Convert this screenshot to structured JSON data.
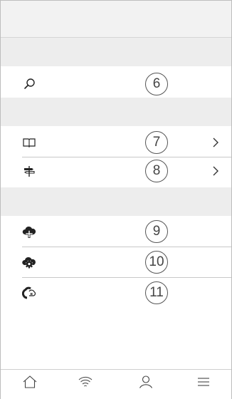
{
  "badges": {
    "search": "6",
    "book": "7",
    "signpost": "8",
    "cloud_add": "9",
    "cloud_settings": "10",
    "cloud_partial": "11"
  },
  "icons": {
    "search": "magnifier-icon",
    "book": "open-book-icon",
    "signpost": "signpost-icon",
    "cloud_add": "cloud-plus-icon",
    "cloud_settings": "cloud-gear-icon",
    "cloud_partial": "cloud-lines-icon",
    "tabs": [
      "home-icon",
      "wifi-icon",
      "user-icon",
      "menu-icon"
    ]
  },
  "colors": {
    "header_bg": "#f2f2f2",
    "section_bg": "#ededed",
    "divider": "#c8c8c8",
    "icon": "#222222"
  }
}
